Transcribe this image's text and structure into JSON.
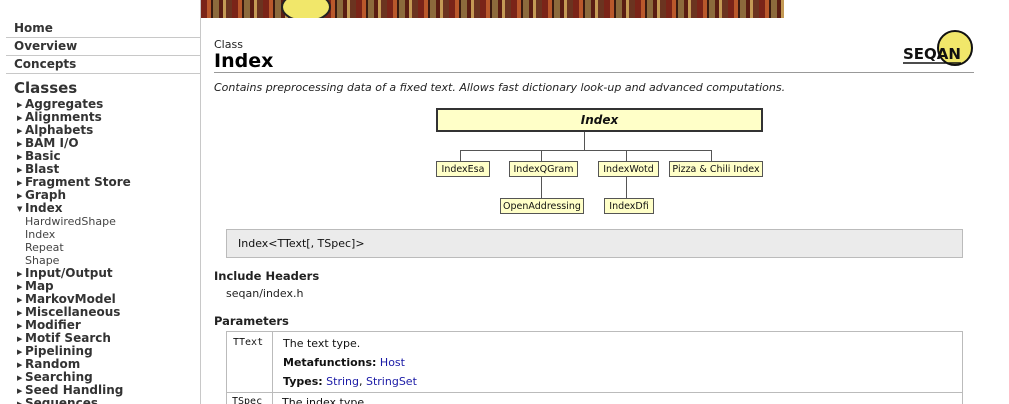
{
  "sidebar": {
    "nav": [
      "Home",
      "Overview",
      "Concepts"
    ],
    "section_title": "Classes",
    "categories": [
      {
        "label": "Aggregates",
        "expanded": false
      },
      {
        "label": "Alignments",
        "expanded": false
      },
      {
        "label": "Alphabets",
        "expanded": false
      },
      {
        "label": "BAM I/O",
        "expanded": false
      },
      {
        "label": "Basic",
        "expanded": false
      },
      {
        "label": "Blast",
        "expanded": false
      },
      {
        "label": "Fragment Store",
        "expanded": false
      },
      {
        "label": "Graph",
        "expanded": false
      },
      {
        "label": "Index",
        "expanded": true
      },
      {
        "label": "Input/Output",
        "expanded": false
      },
      {
        "label": "Map",
        "expanded": false
      },
      {
        "label": "MarkovModel",
        "expanded": false
      },
      {
        "label": "Miscellaneous",
        "expanded": false
      },
      {
        "label": "Modifier",
        "expanded": false
      },
      {
        "label": "Motif Search",
        "expanded": false
      },
      {
        "label": "Pipelining",
        "expanded": false
      },
      {
        "label": "Random",
        "expanded": false
      },
      {
        "label": "Searching",
        "expanded": false
      },
      {
        "label": "Seed Handling",
        "expanded": false
      },
      {
        "label": "Sequences",
        "expanded": false
      }
    ],
    "index_children": [
      "HardwiredShape",
      "Index",
      "Repeat",
      "Shape"
    ]
  },
  "header": {
    "kicker": "Class",
    "title": "Index",
    "logo_text": "SEQAN"
  },
  "description": "Contains preprocessing data of a fixed text. Allows fast dictionary look-up and advanced computations.",
  "diagram": {
    "root": "Index",
    "children": [
      "IndexEsa",
      "IndexQGram",
      "IndexWotd",
      "Pizza & Chili Index"
    ],
    "grandchildren": [
      "OpenAddressing",
      "IndexDfi"
    ]
  },
  "signature": "Index<TText[, TSpec]>",
  "include": {
    "heading": "Include Headers",
    "file": "seqan/index.h"
  },
  "parameters": {
    "heading": "Parameters",
    "rows": [
      {
        "name": "TText",
        "desc": "The text type.",
        "metafunctions_label": "Metafunctions:",
        "metafunctions": "Host",
        "types_label": "Types:",
        "types": [
          "String",
          "StringSet"
        ],
        "types_separator": ", "
      },
      {
        "name": "TSpec",
        "desc": "The index type."
      }
    ]
  },
  "colors": {
    "node_fill": "#ffffc8",
    "link": "#1a1aa6",
    "signature_bg": "#ebebeb",
    "logo_yellow": "#f1e76a"
  }
}
